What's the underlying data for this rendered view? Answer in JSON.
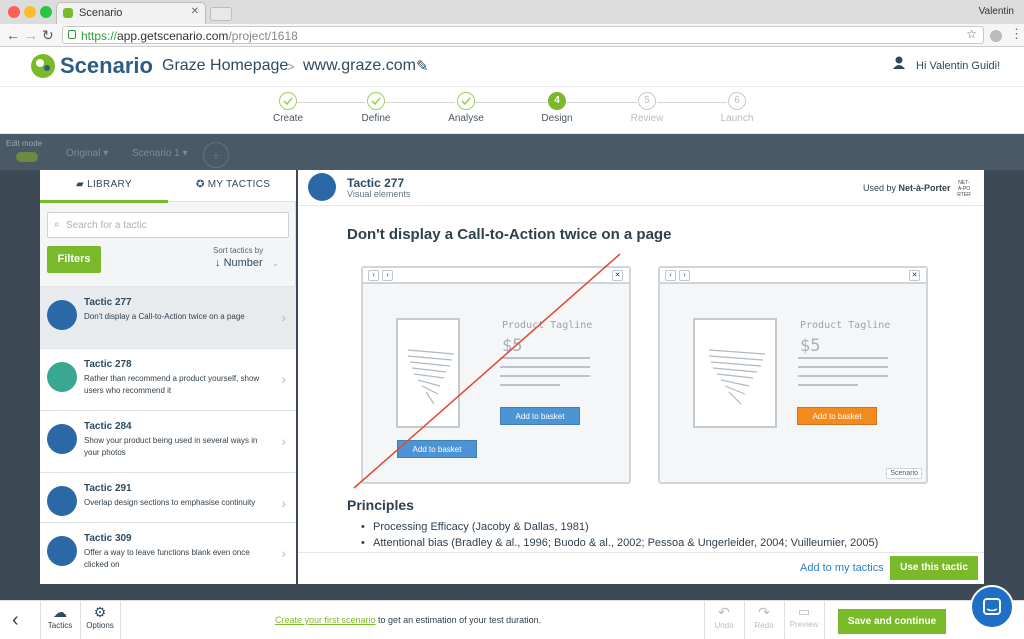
{
  "browser": {
    "tab_title": "Scenario",
    "user": "Valentin",
    "url_scheme": "https://",
    "url_host": "app.getscenario.com",
    "url_path": "/project/1618"
  },
  "header": {
    "brand": "Scenario",
    "project": "Graze Homepage",
    "separator": ">",
    "site": "www.graze.com",
    "greeting": "Hi Valentin Guidi!"
  },
  "steps": [
    {
      "label": "Create",
      "state": "done"
    },
    {
      "label": "Define",
      "state": "done"
    },
    {
      "label": "Analyse",
      "state": "done"
    },
    {
      "label": "Design",
      "num": "4",
      "state": "current"
    },
    {
      "label": "Review",
      "num": "5",
      "state": "todo"
    },
    {
      "label": "Launch",
      "num": "6",
      "state": "todo"
    }
  ],
  "overlay": {
    "edit_mode": "Edit mode",
    "original": "Original",
    "scenario": "Scenario 1"
  },
  "library": {
    "tab_library": "LIBRARY",
    "tab_my": "MY TACTICS",
    "search_placeholder": "Search for a tactic",
    "filters": "Filters",
    "sort_label": "Sort tactics by",
    "sort_value": "Number",
    "items": [
      {
        "title": "Tactic 277",
        "desc": "Don't display a Call-to-Action twice on a page"
      },
      {
        "title": "Tactic 278",
        "desc": "Rather than recommend a product yourself, show users who recommend it"
      },
      {
        "title": "Tactic 284",
        "desc": "Show your product being used in several ways in your photos"
      },
      {
        "title": "Tactic 291",
        "desc": "Overlap design sections to emphasise continuity"
      },
      {
        "title": "Tactic 309",
        "desc": "Offer a way to leave functions blank even once clicked on"
      }
    ]
  },
  "detail": {
    "title": "Tactic 277",
    "subtitle": "Visual elements",
    "used_by_prefix": "Used by",
    "used_by_brand": "Net-à-Porter",
    "brand_logo_text": "NET-A-PORTER",
    "heading": "Don't display a Call-to-Action twice on a page",
    "illustration": {
      "tagline": "Product Tagline",
      "price": "$5",
      "basket": "Add to basket",
      "watermark": "Scenario"
    },
    "principles_title": "Principles",
    "principles": [
      "Processing Efficacy (Jacoby & Dallas, 1981)",
      "Attentional bias (Bradley & al., 1996; Buodo & al., 2002; Pessoa & Ungerleider, 2004; Vuilleumier, 2005)"
    ],
    "add_my": "Add to my tactics",
    "use": "Use this tactic"
  },
  "bottom": {
    "tactics": "Tactics",
    "options": "Options",
    "link": "Create your first scenario",
    "msg": " to get an estimation of your test duration.",
    "undo": "Undo",
    "redo": "Redo",
    "preview": "Preview",
    "save": "Save and continue"
  },
  "colors": {
    "accent": "#7ab929",
    "brand_blue": "#2d5d86",
    "link_blue": "#2f7fc4",
    "cta_orange": "#f28a1e",
    "overlay": "#3d4a55"
  }
}
